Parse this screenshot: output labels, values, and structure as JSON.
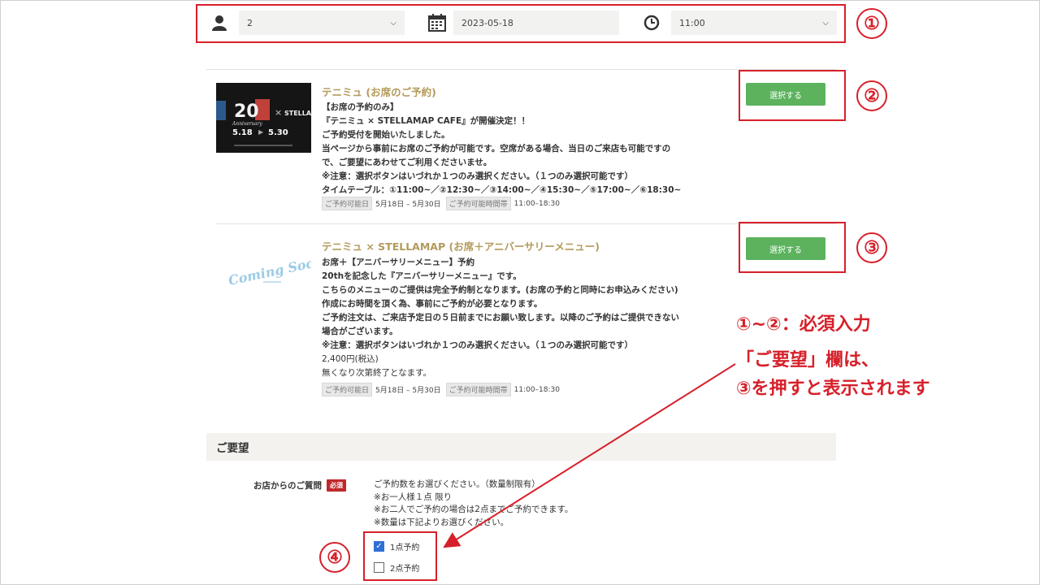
{
  "search": {
    "people": "2",
    "date": "2023-05-18",
    "time": "11:00"
  },
  "cards": [
    {
      "title": "テニミュ (お席のご予約)",
      "image_lines": [
        "20",
        "Anniversary",
        "5.18",
        "5.30",
        "STELLA"
      ],
      "desc": [
        "【お席の予約のみ】",
        "『テニミュ × STELLAMAP CAFE』が開催決定！！",
        "ご予約受付を開始いたしました。",
        "当ページから事前にお席のご予約が可能です。空席がある場合、当日のご来店も可能ですの",
        "で、ご要望にあわせてご利用くださいませ。",
        "※注意：選択ボタンはいづれか１つのみ選択ください。（１つのみ選択可能です）",
        "タイムテーブル：①11:00~／②12:30~／③14:00~／④15:30~／⑤17:00~／⑥18:30~"
      ],
      "tag_date": "ご予約可能日",
      "date_range": "5月18日 – 5月30日",
      "tag_time": "ご予約可能時間帯",
      "time_range": "11:00–18:30",
      "button": "選択する"
    },
    {
      "title": "テニミュ × STELLAMAP (お席＋アニバーサリーメニュー)",
      "image_text": "Coming Soon",
      "desc": [
        "お席＋【アニバーサリーメニュー】予約",
        "20thを記念した『アニバーサリーメニュー』です。",
        "こちらのメニューのご提供は完全予約制となります。(お席の予約と同時にお申込みください)",
        "作成にお時間を頂く為、事前にご予約が必要となります。",
        "ご予約注文は、ご来店予定日の５日前までにお願い致します。以降のご予約はご提供できない",
        "場合がございます。",
        "※注意：選択ボタンはいづれか１つのみ選択ください。（１つのみ選択可能です）"
      ],
      "price": "2,400円(税込)",
      "stock_note": "無くなり次第終了となます。",
      "tag_date": "ご予約可能日",
      "date_range": "5月18日 – 5月30日",
      "tag_time": "ご予約可能時間帯",
      "time_range": "11:00–18:30",
      "button": "選択する"
    }
  ],
  "annotations": {
    "n1": "①",
    "n2": "②",
    "n3": "③",
    "n4": "④",
    "line1": "①~②：必須入力",
    "line2": "「ご要望」欄は、",
    "line3": "③を押すと表示されます"
  },
  "request": {
    "heading": "ご要望",
    "question_label": "お店からのご質問",
    "required": "必須",
    "text": [
      "ご予約数をお選びください。（数量制限有）",
      "※お一人様１点 限り",
      "※お二人でご予約の場合は2点までご予約できます。",
      "※数量は下記よりお選びください。"
    ],
    "options": [
      {
        "label": "1点予約",
        "checked": true
      },
      {
        "label": "2点予約",
        "checked": false
      }
    ]
  },
  "colors": {
    "accent_red": "#d6202a",
    "button_green": "#5cb25d",
    "title_gold": "#b39a5a"
  }
}
